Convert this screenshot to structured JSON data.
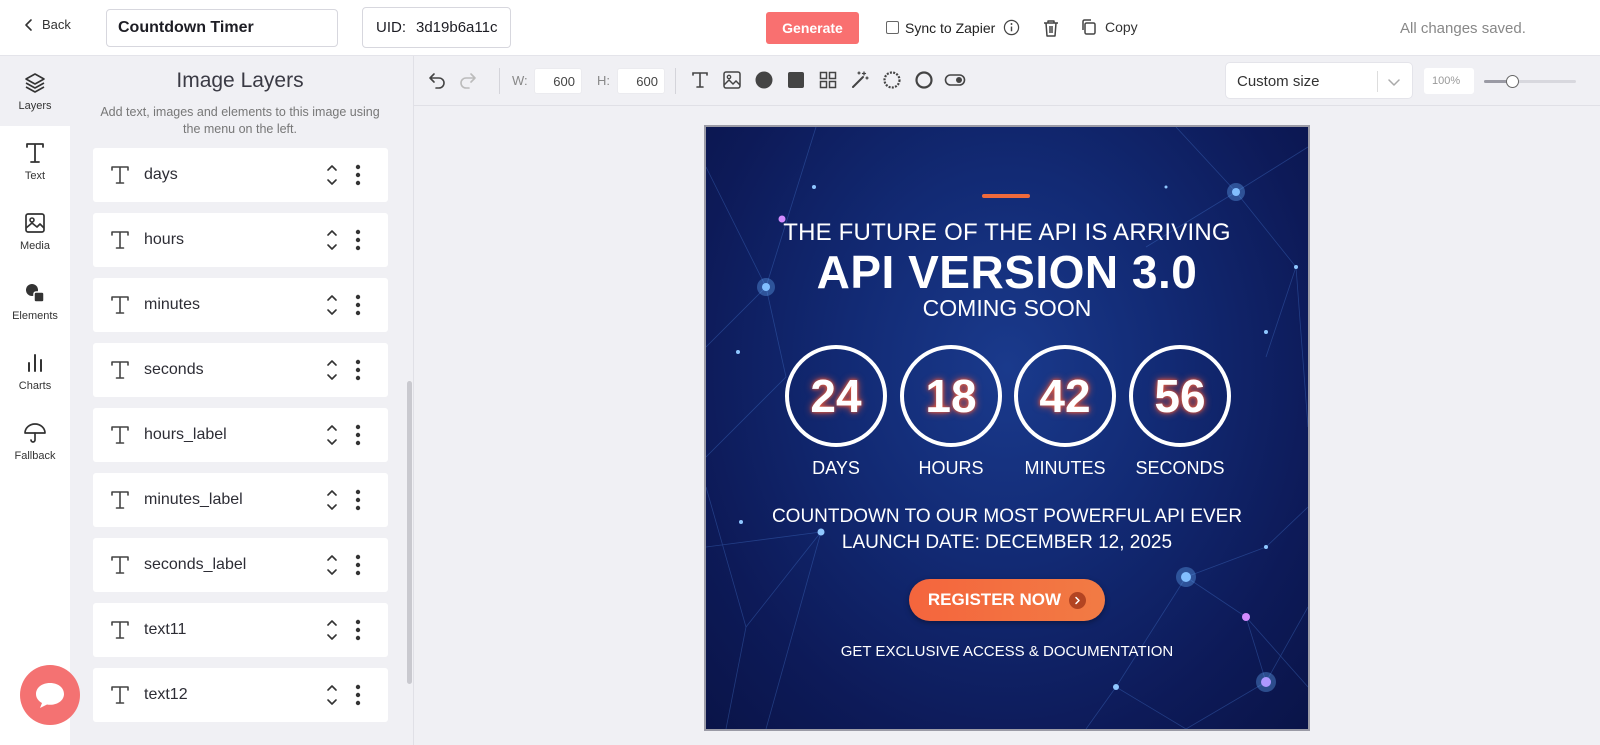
{
  "topbar": {
    "back_label": "Back",
    "title_value": "Countdown Timer",
    "uid_label": "UID:",
    "uid_value": "3d19b6a11c",
    "generate_label": "Generate",
    "sync_label": "Sync to Zapier",
    "copy_label": "Copy",
    "status": "All changes saved."
  },
  "rail": {
    "items": [
      {
        "label": "Layers",
        "icon": "layers-icon"
      },
      {
        "label": "Text",
        "icon": "text-icon"
      },
      {
        "label": "Media",
        "icon": "image-icon"
      },
      {
        "label": "Elements",
        "icon": "shapes-icon"
      },
      {
        "label": "Charts",
        "icon": "bar-chart-icon"
      },
      {
        "label": "Fallback",
        "icon": "umbrella-icon"
      }
    ]
  },
  "layers_panel": {
    "title": "Image Layers",
    "subtitle": "Add text, images and elements to this image using the menu on the left.",
    "layers": [
      {
        "name": "days",
        "type": "text"
      },
      {
        "name": "hours",
        "type": "text"
      },
      {
        "name": "minutes",
        "type": "text"
      },
      {
        "name": "seconds",
        "type": "text"
      },
      {
        "name": "hours_label",
        "type": "text"
      },
      {
        "name": "minutes_label",
        "type": "text"
      },
      {
        "name": "seconds_label",
        "type": "text"
      },
      {
        "name": "text11",
        "type": "text"
      },
      {
        "name": "text12",
        "type": "text"
      }
    ]
  },
  "toolbar": {
    "width_label": "W:",
    "width_value": "600",
    "height_label": "H:",
    "height_value": "600",
    "size_preset": "Custom size",
    "zoom": "100%",
    "zoom_slider_fraction": 0.3,
    "tools": [
      "text-tool-icon",
      "image-tool-icon",
      "circle-tool-icon",
      "square-tool-icon",
      "grid-tool-icon",
      "magic-wand-icon",
      "ring-tool-icon",
      "circle-outline-icon",
      "toggle-tool-icon"
    ]
  },
  "design": {
    "headline_top": "THE FUTURE OF THE API IS ARRIVING",
    "headline_main": "API VERSION 3.0",
    "headline_sub": "COMING SOON",
    "timers": [
      {
        "value": "24",
        "label": "DAYS"
      },
      {
        "value": "18",
        "label": "HOURS"
      },
      {
        "value": "42",
        "label": "MINUTES"
      },
      {
        "value": "56",
        "label": "SECONDS"
      }
    ],
    "body_line1": "COUNTDOWN TO OUR MOST POWERFUL API EVER",
    "body_line2": "LAUNCH DATE: DECEMBER 12, 2025",
    "cta_label": "REGISTER NOW",
    "footer": "GET EXCLUSIVE ACCESS & DOCUMENTATION"
  },
  "colors": {
    "accent": "#f97070",
    "cta": "#f4653d",
    "canvas_bg": "#122a74"
  }
}
